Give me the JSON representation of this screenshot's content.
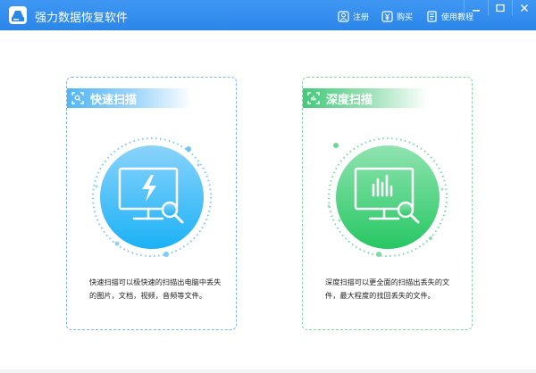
{
  "window": {
    "title": "强力数据恢复软件",
    "links": {
      "register": "注册",
      "buy": "购买",
      "tutorial": "使用教程"
    }
  },
  "cards": {
    "quick": {
      "title": "快速扫描",
      "description": "快速扫描可以极快速的扫描出电脑中丢失的图片，文档，视频，音频等文件。",
      "color": "#2fb2f6"
    },
    "deep": {
      "title": "深度扫描",
      "description": "深度扫描可以更全面的扫描出丢失的文件，最大程度的找回丢失的文件。",
      "color": "#35cc6f"
    }
  },
  "colors": {
    "titlebar": "#3f97f2",
    "quick_border": "#7fb6e6",
    "deep_border": "#86d8a7"
  }
}
